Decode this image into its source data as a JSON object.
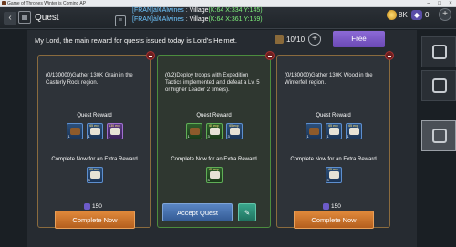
{
  "window": {
    "title": "Game of Thrones Winter is Coming AP"
  },
  "topbar": {
    "title": "Quest",
    "chat": [
      {
        "tag": "[FRAN]",
        "name": "àî¢Alwines",
        "sep": " : ",
        "loc": "Village",
        "coord": "(K:64 X:334 Y:145)"
      },
      {
        "tag": "[FRAN]",
        "name": "àî¢Alwines",
        "sep": " : ",
        "loc": "Village",
        "coord": "(K:64 X:361 Y:159)"
      }
    ],
    "gold": "8K",
    "gems": "0"
  },
  "header": {
    "message": "My Lord, the main reward for quests issued today is Lord's Helmet.",
    "quest_count": "10/10",
    "free_label": "Free"
  },
  "cards": [
    {
      "progress": "(0/130000)",
      "text": "Gather 130K Grain in the Casterly Rock region.",
      "reward_title": "Quest Reward",
      "extra_title": "Complete Now for an Extra Reward",
      "rewards": [
        {
          "tag": "",
          "qty": "1",
          "kind": "chest",
          "color": "blue"
        },
        {
          "tag": "65 exp",
          "qty": "1",
          "kind": "scroll",
          "color": "blue"
        },
        {
          "tag": "130 exp",
          "qty": "1",
          "kind": "scroll",
          "color": "purple"
        }
      ],
      "extra": [
        {
          "tag": "65 exp",
          "qty": "3",
          "kind": "scroll",
          "color": "blue"
        }
      ],
      "cost": "150",
      "button": "Complete Now"
    },
    {
      "progress": "(0/2)",
      "text": "Deploy troops with Expedition Tactics implemented and defeat a Lv. 5 or higher Leader 2 time(s).",
      "reward_title": "Quest Reward",
      "extra_title": "Complete Now for an Extra Reward",
      "rewards": [
        {
          "tag": "",
          "qty": "1",
          "kind": "chest",
          "color": "green"
        },
        {
          "tag": "65 exp",
          "qty": "3",
          "kind": "scroll",
          "color": "green"
        },
        {
          "tag": "65 exp",
          "qty": "3",
          "kind": "scroll",
          "color": "blue"
        }
      ],
      "extra": [
        {
          "tag": "65 exp",
          "qty": "3",
          "kind": "scroll",
          "color": "green"
        }
      ],
      "cost": "",
      "button": "Accept Quest"
    },
    {
      "progress": "(0/130000)",
      "text": "Gather 130K Wood in the Winterfell region.",
      "reward_title": "Quest Reward",
      "extra_title": "Complete Now for an Extra Reward",
      "rewards": [
        {
          "tag": "",
          "qty": "1",
          "kind": "chest",
          "color": "blue"
        },
        {
          "tag": "65 exp",
          "qty": "1",
          "kind": "scroll",
          "color": "blue"
        },
        {
          "tag": "65 exp",
          "qty": "1",
          "kind": "scroll",
          "color": "blue"
        }
      ],
      "extra": [
        {
          "tag": "65 exp",
          "qty": "3",
          "kind": "scroll",
          "color": "blue"
        }
      ],
      "cost": "150",
      "button": "Complete Now"
    }
  ],
  "side_tabs": [
    {
      "name": "quest-map-icon",
      "active": false
    },
    {
      "name": "shield-sword-icon",
      "active": false
    },
    {
      "name": "banner-icon",
      "active": true
    }
  ]
}
